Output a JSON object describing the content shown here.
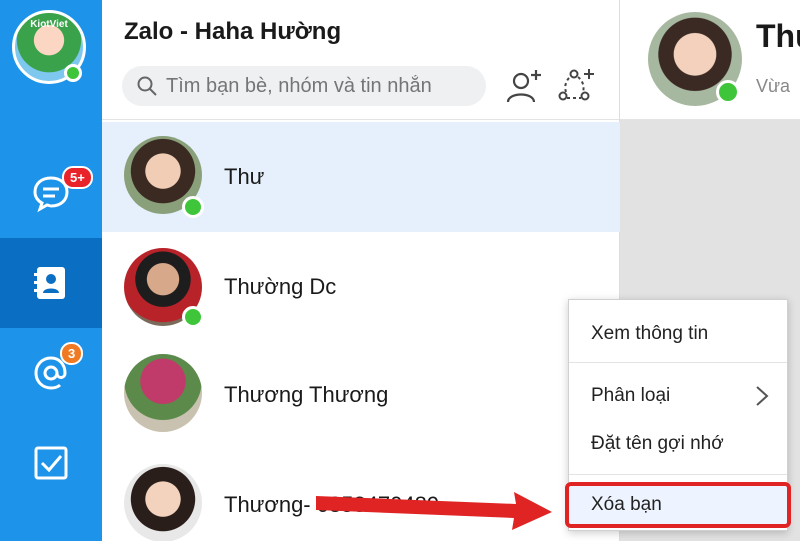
{
  "sidebar": {
    "avatar_brand": "KiotViet",
    "nav": [
      {
        "icon": "message-icon",
        "badge": "5+"
      },
      {
        "icon": "contacts-icon",
        "badge": ""
      },
      {
        "icon": "mention-icon",
        "badge": "3"
      },
      {
        "icon": "todo-icon",
        "badge": ""
      }
    ]
  },
  "header": {
    "title": "Zalo - Haha Hường",
    "search_placeholder": "Tìm bạn bè, nhóm và tin nhắn"
  },
  "contacts": [
    {
      "name": "Thư",
      "online": true
    },
    {
      "name": "Thường Dc",
      "online": true
    },
    {
      "name": "Thương Thương",
      "online": false
    },
    {
      "name": "Thương- 0358470489",
      "online": false
    }
  ],
  "chat": {
    "name": "Thư",
    "status": "Vừa"
  },
  "context_menu": {
    "view_info": "Xem thông tin",
    "categorize": "Phân loại",
    "nickname": "Đặt tên gợi nhớ",
    "delete_friend": "Xóa bạn"
  },
  "colors": {
    "sidebar": "#1d93ea",
    "sidebar_active": "#0a6fc2",
    "online": "#3fc53a",
    "badge_red": "#e8232a",
    "badge_orange": "#f07a24",
    "highlight": "#e02424"
  }
}
